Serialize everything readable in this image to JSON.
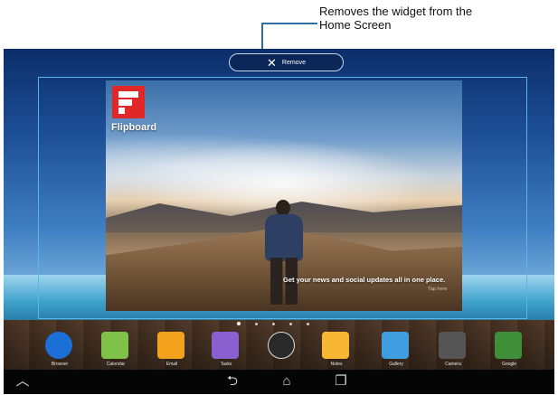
{
  "callout": {
    "line1": "Removes the widget from the",
    "line2": "Home Screen"
  },
  "remove_bar": {
    "label": "Remove",
    "icon": "close-icon"
  },
  "widget": {
    "brand": "Flipboard",
    "tagline": "Get your news and social updates all in one place.",
    "tap_hint": "Tap here"
  },
  "page_indicator": {
    "count": 5,
    "active_index": 0
  },
  "dock": {
    "apps": [
      {
        "label": "Browser",
        "icon": "globe-icon",
        "color": "#1b6fd6"
      },
      {
        "label": "Calendar",
        "icon": "calendar-icon",
        "color": "#7ec24a"
      },
      {
        "label": "Email",
        "icon": "envelope-icon",
        "color": "#f2a21b"
      },
      {
        "label": "Tasks",
        "icon": "checklist-icon",
        "color": "#8a5fd0"
      },
      {
        "label": "",
        "icon": "all-apps-icon",
        "color": "#2a2a2a"
      },
      {
        "label": "Notes",
        "icon": "notepad-icon",
        "color": "#f7b733"
      },
      {
        "label": "Gallery",
        "icon": "picture-icon",
        "color": "#3f9de0"
      },
      {
        "label": "Camera",
        "icon": "camera-icon",
        "color": "#555555"
      },
      {
        "label": "Google",
        "icon": "google-folder-icon",
        "color": "#3e8e3a"
      }
    ]
  },
  "navbar": {
    "buttons": [
      {
        "name": "menu-up",
        "icon": "chevron-up-icon"
      },
      {
        "name": "back",
        "icon": "back-icon"
      },
      {
        "name": "home",
        "icon": "home-icon"
      },
      {
        "name": "recent",
        "icon": "recent-apps-icon"
      }
    ]
  }
}
